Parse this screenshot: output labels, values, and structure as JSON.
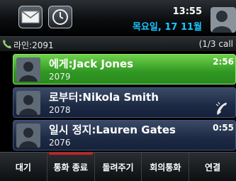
{
  "status": {
    "time": "13:55",
    "date": "목요일, 17 11월",
    "icons": [
      "mail-icon",
      "clock-icon",
      "user-avatar-icon"
    ]
  },
  "line": {
    "label": "라인:2091",
    "count": "(1/3 call",
    "icon": "handset-icon"
  },
  "calls": [
    {
      "name": "에게:Jack Jones",
      "number": "2079",
      "timer": "2:56",
      "state": "active"
    },
    {
      "name": "로부터:Nikola Smith",
      "number": "2078",
      "timer": "",
      "state": "ringing"
    },
    {
      "name": "일시 정지:Lauren Gates",
      "number": "2076",
      "timer": "0:55",
      "state": "held"
    }
  ],
  "softkeys": [
    {
      "label": "대기"
    },
    {
      "label": "통화 종료"
    },
    {
      "label": "돌려주기"
    },
    {
      "label": "회의통화"
    },
    {
      "label": "연결"
    }
  ],
  "colors": {
    "accent_blue": "#19c6ff",
    "active_call_green": "#2f9722",
    "held_call_navy": "#1d2a44",
    "end_call_red": "#d21d1d"
  }
}
